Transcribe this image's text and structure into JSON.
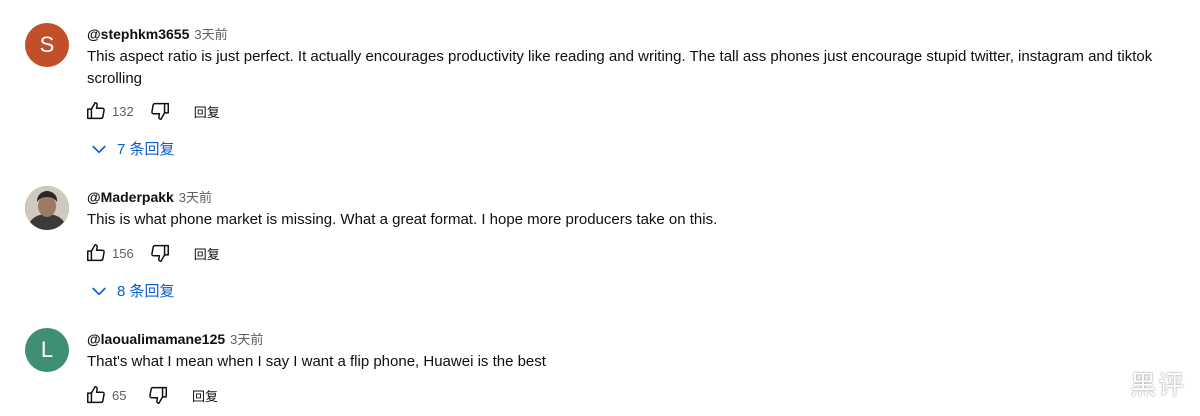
{
  "colors": {
    "accent_link": "#065fd4",
    "text_primary": "#0f0f0f",
    "text_secondary": "#606060"
  },
  "comments": [
    {
      "avatar": {
        "type": "letter",
        "letter": "S",
        "color": "#c1502a"
      },
      "author": "@stephkm3655",
      "time": "3天前",
      "text": "This aspect ratio is just perfect. It actually encourages productivity like reading and writing. The tall ass phones just encourage stupid twitter, instagram and tiktok scrolling",
      "likes": "132",
      "reply_label": "回复",
      "replies_toggle": "7 条回复",
      "icons": {
        "like": "thumbs-up-icon",
        "dislike": "thumbs-down-icon",
        "expand": "chevron-down-icon"
      }
    },
    {
      "avatar": {
        "type": "photo",
        "color": "#6e6a63"
      },
      "author": "@Maderpakk",
      "time": "3天前",
      "text": "This is what phone market is missing. What a great format. I hope more producers take on this.",
      "likes": "156",
      "reply_label": "回复",
      "replies_toggle": "8 条回复",
      "icons": {
        "like": "thumbs-up-icon",
        "dislike": "thumbs-down-icon",
        "expand": "chevron-down-icon"
      }
    },
    {
      "avatar": {
        "type": "letter",
        "letter": "L",
        "color": "#3f8f73"
      },
      "author": "@laoualimamane125",
      "time": "3天前",
      "text": "That's what I mean when I say I want a flip phone, Huawei is the best",
      "likes": "65",
      "reply_label": "回复",
      "icons": {
        "like": "thumbs-up-icon",
        "dislike": "thumbs-down-icon"
      }
    }
  ],
  "watermark": "黑评"
}
